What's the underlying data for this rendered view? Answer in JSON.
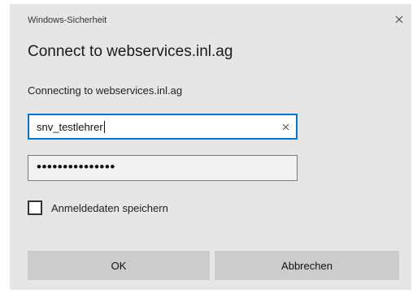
{
  "window": {
    "title": "Windows-Sicherheit",
    "close_icon": "close-icon"
  },
  "dialog": {
    "heading": "Connect to webservices.inl.ag",
    "subtext": "Connecting to webservices.inl.ag"
  },
  "username": {
    "value": "snv_testlehrer",
    "clear_icon": "clear-icon",
    "focused": true
  },
  "password": {
    "masked_value": "•••••••••••••••"
  },
  "remember": {
    "label": "Anmeldedaten speichern",
    "checked": false
  },
  "buttons": {
    "ok_label": "OK",
    "cancel_label": "Abbrechen"
  },
  "colors": {
    "dialog_bg": "#e6e6e6",
    "focus_border": "#0078d7",
    "button_bg": "#cccccc"
  }
}
